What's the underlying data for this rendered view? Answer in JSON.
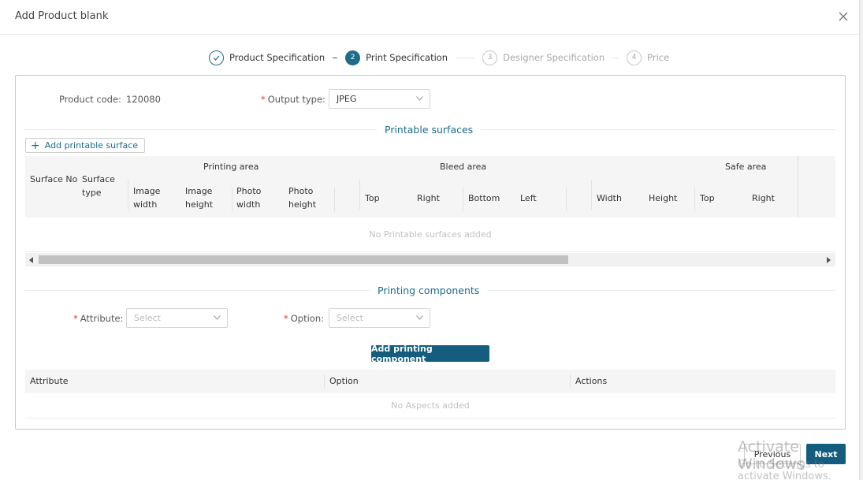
{
  "modal": {
    "title": "Add Product blank"
  },
  "steps": [
    {
      "label": "Product Specification",
      "state": "done",
      "number": ""
    },
    {
      "label": "Print Specification",
      "state": "active",
      "number": "2"
    },
    {
      "label": "Designer Specification",
      "state": "pending",
      "number": "3"
    },
    {
      "label": "Price",
      "state": "pending",
      "number": "4"
    }
  ],
  "form": {
    "product_code_label": "Product code:",
    "product_code_value": "120080",
    "output_type_label": "Output type:",
    "output_type_value": "JPEG"
  },
  "printable_surfaces": {
    "title": "Printable surfaces",
    "add_button": "Add printable surface",
    "columns": {
      "surface_no": "Surface No",
      "surface_type": "Surface type",
      "printing_area": "Printing area",
      "image_width": "Image width",
      "image_height": "Image height",
      "photo_width": "Photo width",
      "photo_height": "Photo height",
      "bleed_area": "Bleed area",
      "bleed_top": "Top",
      "bleed_right": "Right",
      "bleed_bottom": "Bottom",
      "bleed_left": "Left",
      "width": "Width",
      "height": "Height",
      "safe_area": "Safe area",
      "safe_top": "Top",
      "safe_right": "Right"
    },
    "empty_text": "No Printable surfaces added"
  },
  "printing_components": {
    "title": "Printing components",
    "attribute_label": "Attribute:",
    "attribute_placeholder": "Select",
    "option_label": "Option:",
    "option_placeholder": "Select",
    "add_button": "Add printing component",
    "columns": [
      "Attribute",
      "Option",
      "Actions"
    ],
    "empty_text": "No Aspects added"
  },
  "footer": {
    "previous": "Previous",
    "next": "Next"
  },
  "watermark": {
    "line1": "Activate Windows",
    "line2": "Go to Settings to activate Windows."
  },
  "colors": {
    "accent": "#1d6c8a",
    "button": "#155d7f",
    "required": "#e53935"
  }
}
